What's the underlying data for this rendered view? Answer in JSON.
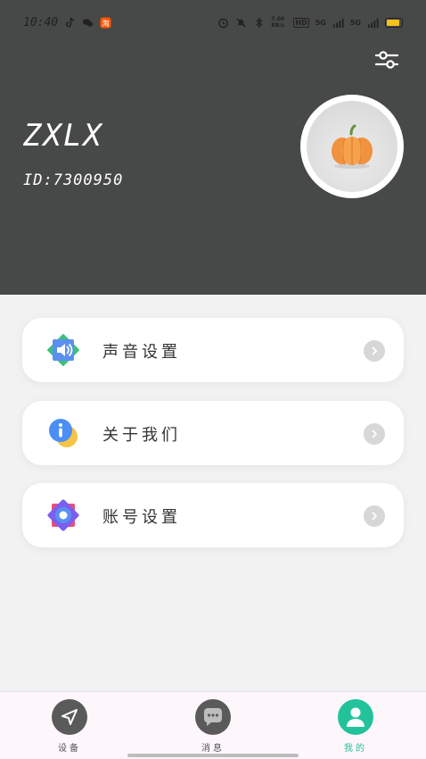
{
  "status_bar": {
    "time": "10:40",
    "net_speed": "7.00 KB/s",
    "sim1": "5G",
    "sim2": "5G",
    "hd_label": "HD"
  },
  "profile": {
    "username": "ZXLX",
    "id_text": "ID:7300950"
  },
  "menu": [
    {
      "label": "声音设置",
      "icon": "speaker-icon"
    },
    {
      "label": "关于我们",
      "icon": "info-icon"
    },
    {
      "label": "账号设置",
      "icon": "account-gear-icon"
    }
  ],
  "bottom_nav": [
    {
      "label": "设备",
      "icon": "navigation-arrow-icon",
      "active": false
    },
    {
      "label": "消息",
      "icon": "chat-bubble-icon",
      "active": false
    },
    {
      "label": "我的",
      "icon": "person-icon",
      "active": true
    }
  ],
  "colors": {
    "header_bg": "#474848",
    "page_bg": "#f2f2f2",
    "active_tab": "#22c39b",
    "nav_bg": "#fdf6fb"
  }
}
